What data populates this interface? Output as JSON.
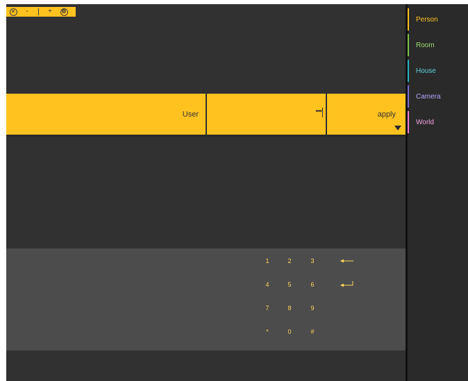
{
  "window_controls": {
    "close_icon": "close-circle-icon",
    "minus_label": "-",
    "plus_label": "+",
    "settings_icon": "gear-circle-icon"
  },
  "login_bar": {
    "user_label": "User",
    "password_value": "••••",
    "apply_label": "apply"
  },
  "keypad": {
    "rows": [
      [
        "1",
        "2",
        "3",
        "backspace-arrow-icon"
      ],
      [
        "4",
        "5",
        "6",
        "enter-return-icon"
      ],
      [
        "7",
        "8",
        "9",
        ""
      ],
      [
        "*",
        "0",
        "#",
        ""
      ]
    ]
  },
  "sidebar": {
    "items": [
      {
        "label": "Person",
        "color": "#ffc21f",
        "text_color": "#ffc21f"
      },
      {
        "label": "Room",
        "color": "#7cc546",
        "text_color": "#9fdc70"
      },
      {
        "label": "House",
        "color": "#29b0b8",
        "text_color": "#5fd3da"
      },
      {
        "label": "Camera",
        "color": "#7e6bd6",
        "text_color": "#b3a6ff"
      },
      {
        "label": "World",
        "color": "#f07fd8",
        "text_color": "#f8a2e6"
      }
    ]
  },
  "colors": {
    "accent": "#ffc21f",
    "background": "#313131",
    "keypad_background": "#4c4c4c",
    "sidebar_background": "#2a2a2a",
    "key_text": "#ffd55a"
  }
}
